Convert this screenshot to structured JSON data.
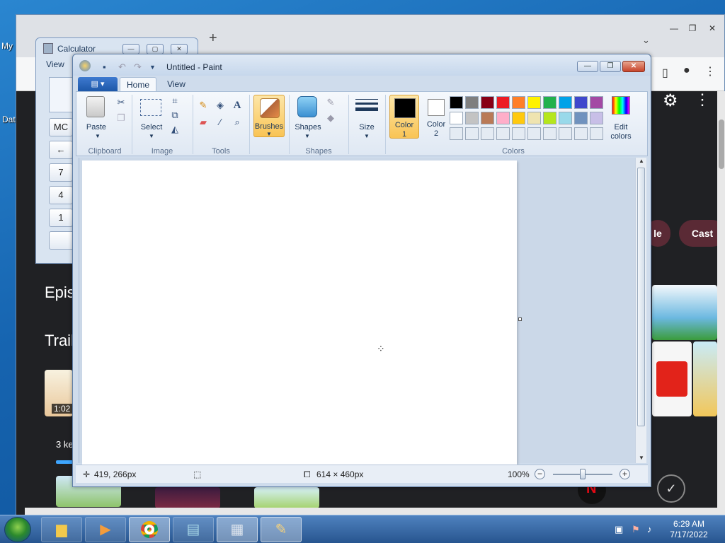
{
  "desktop": {
    "icon_labels": [
      "My",
      "Dat"
    ]
  },
  "browser": {
    "new_tab_symbol": "+",
    "chevron": "⌄",
    "pills": [
      "le",
      "Cast"
    ],
    "headings": [
      "Epis",
      "Trail"
    ],
    "subtext": "3 ke",
    "thumb_badge": "1:02"
  },
  "calculator": {
    "title": "Calculator",
    "menu": "View",
    "buttons": [
      "MC",
      "←",
      "7",
      "4",
      "1"
    ]
  },
  "paint": {
    "title": "Untitled - Paint",
    "tabs": [
      "Home",
      "View"
    ],
    "ribbon": {
      "paste": "Paste",
      "select": "Select",
      "brushes": "Brushes",
      "shapes": "Shapes",
      "size": "Size",
      "color1": "Color\n1",
      "color1_line1": "Color",
      "color1_line2": "1",
      "color2_line1": "Color",
      "color2_line2": "2",
      "edit_colors_line1": "Edit",
      "edit_colors_line2": "colors",
      "groups": [
        "Clipboard",
        "Image",
        "Tools",
        "Shapes",
        "Colors"
      ]
    },
    "color1_value": "#000000",
    "color2_value": "#ffffff",
    "palette_row1": [
      "#000000",
      "#7f7f7f",
      "#880015",
      "#ed1c24",
      "#ff7f27",
      "#fff200",
      "#22b14c",
      "#00a2e8",
      "#3f48cc",
      "#a349a4"
    ],
    "palette_row2": [
      "#ffffff",
      "#c3c3c3",
      "#b97a57",
      "#ffaec9",
      "#ffc90e",
      "#efe4b0",
      "#b5e61d",
      "#99d9ea",
      "#7092be",
      "#c8bfe7"
    ],
    "status": {
      "cursor_pos": "419, 266px",
      "canvas_size": "614 × 460px",
      "zoom": "100%"
    }
  },
  "taskbar": {
    "time": "6:29 AM",
    "date": "7/17/2022"
  }
}
